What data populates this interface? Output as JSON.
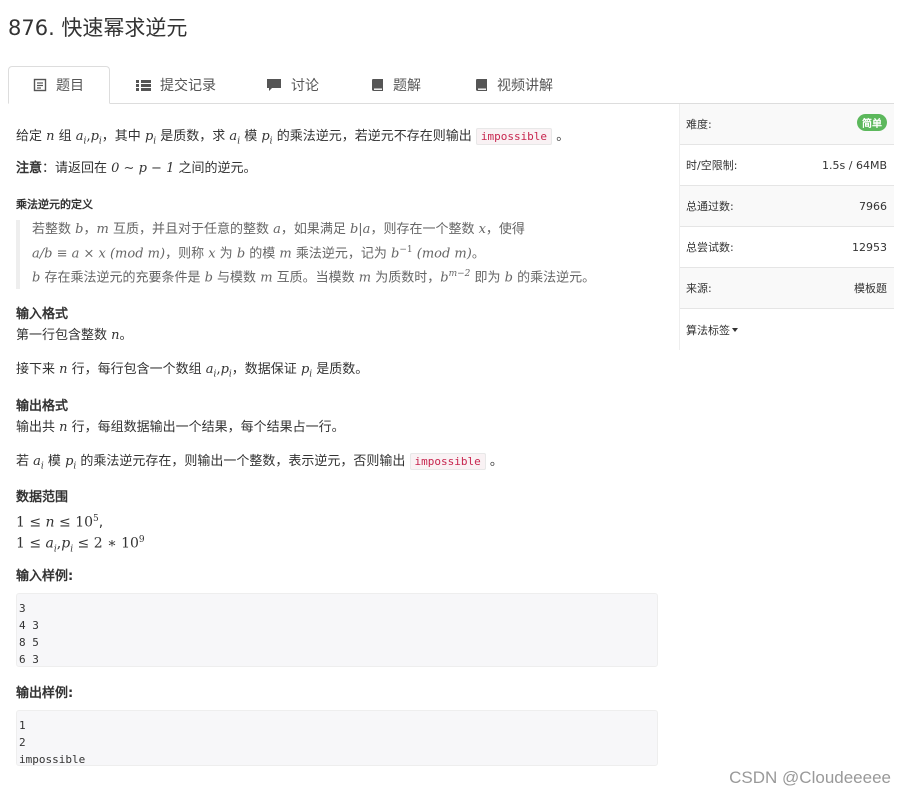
{
  "title": "876. 快速幂求逆元",
  "tabs": [
    {
      "label": "题目",
      "icon": "document-icon"
    },
    {
      "label": "提交记录",
      "icon": "list-icon"
    },
    {
      "label": "讨论",
      "icon": "comment-icon"
    },
    {
      "label": "题解",
      "icon": "book-icon"
    },
    {
      "label": "视频讲解",
      "icon": "book-icon"
    }
  ],
  "problem": {
    "intro": {
      "t1": "给定 ",
      "t2": " 组 ",
      "t3": "，其中 ",
      "t4": " 是质数，求 ",
      "t5": " 模 ",
      "t6": " 的乘法逆元，若逆元不存在则输出 ",
      "t7": " 。",
      "n": "n",
      "ai": "a",
      "pi": "p",
      "sub_i": "i",
      "comma": ","
    },
    "note": {
      "label": "注意",
      "text1": "：请返回在 ",
      "math": "0 ∼ p − 1",
      "text2": " 之间的逆元。"
    },
    "def_title": "乘法逆元的定义",
    "def": {
      "l1a": "若整数 ",
      "l1b": "b",
      "l1c": "，",
      "l1d": "m",
      "l1e": " 互质，并且对于任意的整数 ",
      "l1f": "a",
      "l1g": "，如果满足 ",
      "l1h": "b|a",
      "l1i": "，则存在一个整数 ",
      "l1j": "x",
      "l1k": "，使得",
      "l2a": "a/b ≡ a × x (mod m)",
      "l2b": "，则称 ",
      "l2c": "x",
      "l2d": " 为 ",
      "l2e": "b",
      "l2f": " 的模 ",
      "l2g": "m",
      "l2h": " 乘法逆元，记为 ",
      "l2i": "b",
      "l2sup": "−1",
      "l2j": " (mod m)",
      "l2k": "。",
      "l3a": "b",
      "l3b": " 存在乘法逆元的充要条件是 ",
      "l3c": "b",
      "l3d": " 与模数 ",
      "l3e": "m",
      "l3f": " 互质。当模数 ",
      "l3g": "m",
      "l3h": " 为质数时，",
      "l3i": "b",
      "l3sup": "m−2",
      "l3j": " 即为 ",
      "l3k": "b",
      "l3l": " 的乘法逆元。"
    },
    "input_title": "输入格式",
    "input1": {
      "a": "第一行包含整数 ",
      "b": "n",
      "c": "。"
    },
    "input2": {
      "a": "接下来 ",
      "b": "n",
      "c": " 行，每行包含一个数组 ",
      "d": "，数据保证 ",
      "e": " 是质数。"
    },
    "output_title": "输出格式",
    "output1": {
      "a": "输出共 ",
      "b": "n",
      "c": " 行，每组数据输出一个结果，每个结果占一行。"
    },
    "output2": {
      "a": "若 ",
      "b": " 模 ",
      "c": " 的乘法逆元存在，则输出一个整数，表示逆元，否则输出 ",
      "d": " 。"
    },
    "range_title": "数据范围",
    "range1": {
      "a": "1 ≤ ",
      "b": "n",
      "c": " ≤ 10",
      "sup": "5",
      "d": ","
    },
    "range2": {
      "a": "1 ≤ ",
      "b": " ≤ 2 ∗ 10",
      "sup": "9"
    },
    "impossible": "impossible",
    "sample_in_title": "输入样例:",
    "sample_in": [
      "3",
      "4 3",
      "8 5",
      "6 3"
    ],
    "sample_out_title": "输出样例:",
    "sample_out": [
      "1",
      "2",
      "impossible"
    ]
  },
  "sidebar": {
    "difficulty_label": "难度:",
    "difficulty_value": "简单",
    "limit_label": "时/空限制:",
    "limit_value": "1.5s / 64MB",
    "passed_label": "总通过数:",
    "passed_value": "7966",
    "tried_label": "总尝试数:",
    "tried_value": "12953",
    "source_label": "来源:",
    "source_value": "模板题",
    "tags_label": "算法标签"
  },
  "watermark": "CSDN @Cloudeeeee",
  "colors": {
    "badge": "#5cb85c",
    "code": "#c7254e",
    "border": "#dddddd"
  }
}
